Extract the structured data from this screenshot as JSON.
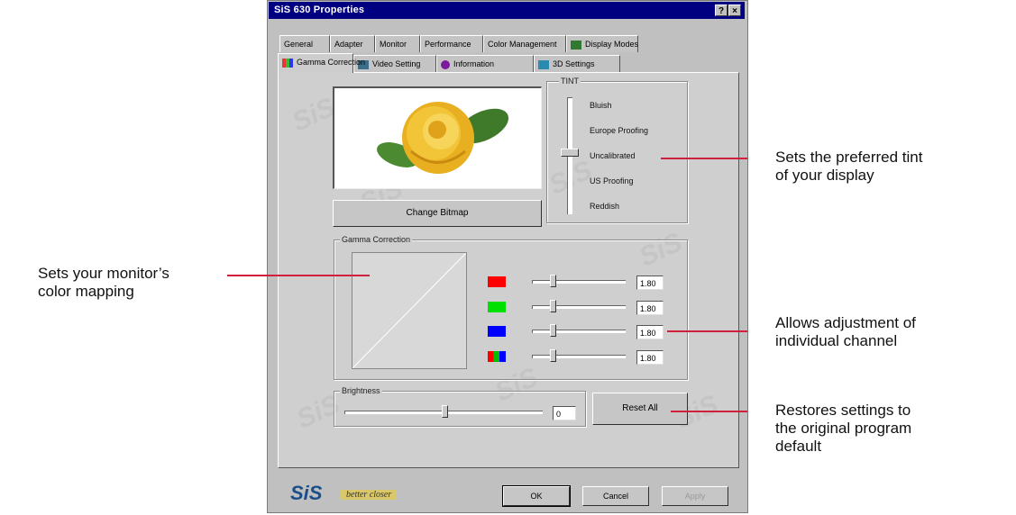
{
  "window": {
    "title": "SiS 630 Properties",
    "help_btn": "?",
    "close_btn": "×"
  },
  "tabs_back": [
    {
      "label": "General"
    },
    {
      "label": "Adapter"
    },
    {
      "label": "Monitor"
    },
    {
      "label": "Performance"
    },
    {
      "label": "Color Management"
    },
    {
      "label": "Display Modes"
    }
  ],
  "tabs_front": [
    {
      "label": "Gamma Correction"
    },
    {
      "label": "Video Setting"
    },
    {
      "label": "Information"
    },
    {
      "label": "3D Settings"
    }
  ],
  "preview": {
    "button_label": "Change Bitmap"
  },
  "tint": {
    "group_label": "TINT",
    "options": [
      "Bluish",
      "Europe Proofing",
      "Uncalibrated",
      "US Proofing",
      "Reddish"
    ],
    "selected": "Uncalibrated"
  },
  "gamma": {
    "group_label": "Gamma Correction",
    "channels": [
      {
        "name": "red",
        "color": "#ff0000",
        "value": "1.80"
      },
      {
        "name": "green",
        "color": "#00e000",
        "value": "1.80"
      },
      {
        "name": "blue",
        "color": "#0000ff",
        "value": "1.80"
      },
      {
        "name": "all",
        "color": "#ff0000",
        "value": "1.80"
      }
    ]
  },
  "brightness": {
    "group_label": "Brightness",
    "value": "0",
    "reset_label": "Reset All"
  },
  "footer": {
    "logo": "SiS",
    "tagline": "better closer",
    "ok": "OK",
    "cancel": "Cancel",
    "apply": "Apply"
  },
  "annotations": {
    "tint": [
      "Sets the preferred tint",
      "of your display"
    ],
    "gamma": [
      "Sets your monitor’s",
      "color mapping"
    ],
    "channel": [
      "Allows adjustment of",
      "individual channel"
    ],
    "reset": [
      "Restores settings to",
      "the original program",
      "default"
    ]
  },
  "accent_color": "#d0203c",
  "title_bar_color": "#000080"
}
